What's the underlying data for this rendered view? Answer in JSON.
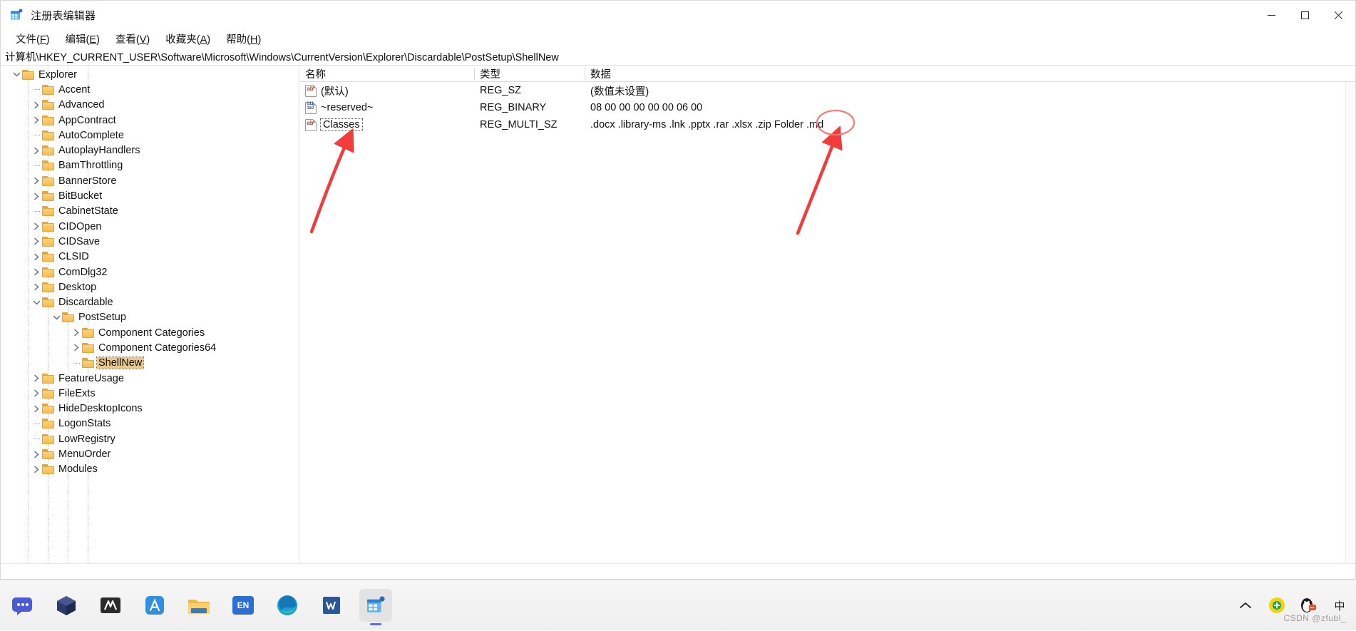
{
  "window": {
    "title": "注册表编辑器",
    "app_icon": "registry-editor-icon",
    "controls": {
      "minimize": "最小化",
      "maximize": "最大化",
      "close": "关闭"
    }
  },
  "menubar": {
    "items": [
      {
        "label": "文件(F)",
        "text": "文件",
        "accel": "F"
      },
      {
        "label": "编辑(E)",
        "text": "编辑",
        "accel": "E"
      },
      {
        "label": "查看(V)",
        "text": "查看",
        "accel": "V"
      },
      {
        "label": "收藏夹(A)",
        "text": "收藏夹",
        "accel": "A"
      },
      {
        "label": "帮助(H)",
        "text": "帮助",
        "accel": "H"
      }
    ]
  },
  "address": {
    "path": "计算机\\HKEY_CURRENT_USER\\Software\\Microsoft\\Windows\\CurrentVersion\\Explorer\\Discardable\\PostSetup\\ShellNew"
  },
  "tree": {
    "items": [
      {
        "label": "Explorer",
        "indent": 0,
        "state": "expanded",
        "selected": false
      },
      {
        "label": "Accent",
        "indent": 1,
        "state": "leaf",
        "selected": false
      },
      {
        "label": "Advanced",
        "indent": 1,
        "state": "collapsed",
        "selected": false
      },
      {
        "label": "AppContract",
        "indent": 1,
        "state": "collapsed",
        "selected": false
      },
      {
        "label": "AutoComplete",
        "indent": 1,
        "state": "leaf",
        "selected": false
      },
      {
        "label": "AutoplayHandlers",
        "indent": 1,
        "state": "collapsed",
        "selected": false
      },
      {
        "label": "BamThrottling",
        "indent": 1,
        "state": "leaf",
        "selected": false
      },
      {
        "label": "BannerStore",
        "indent": 1,
        "state": "collapsed",
        "selected": false
      },
      {
        "label": "BitBucket",
        "indent": 1,
        "state": "collapsed",
        "selected": false
      },
      {
        "label": "CabinetState",
        "indent": 1,
        "state": "leaf",
        "selected": false
      },
      {
        "label": "CIDOpen",
        "indent": 1,
        "state": "collapsed",
        "selected": false
      },
      {
        "label": "CIDSave",
        "indent": 1,
        "state": "collapsed",
        "selected": false
      },
      {
        "label": "CLSID",
        "indent": 1,
        "state": "collapsed",
        "selected": false
      },
      {
        "label": "ComDlg32",
        "indent": 1,
        "state": "collapsed",
        "selected": false
      },
      {
        "label": "Desktop",
        "indent": 1,
        "state": "collapsed",
        "selected": false
      },
      {
        "label": "Discardable",
        "indent": 1,
        "state": "expanded",
        "selected": false
      },
      {
        "label": "PostSetup",
        "indent": 2,
        "state": "expanded",
        "selected": false
      },
      {
        "label": "Component Categories",
        "indent": 3,
        "state": "collapsed",
        "selected": false
      },
      {
        "label": "Component Categories64",
        "indent": 3,
        "state": "collapsed",
        "selected": false
      },
      {
        "label": "ShellNew",
        "indent": 3,
        "state": "leaf",
        "selected": true
      },
      {
        "label": "FeatureUsage",
        "indent": 1,
        "state": "collapsed",
        "selected": false
      },
      {
        "label": "FileExts",
        "indent": 1,
        "state": "collapsed",
        "selected": false
      },
      {
        "label": "HideDesktopIcons",
        "indent": 1,
        "state": "collapsed",
        "selected": false
      },
      {
        "label": "LogonStats",
        "indent": 1,
        "state": "leaf",
        "selected": false
      },
      {
        "label": "LowRegistry",
        "indent": 1,
        "state": "leaf",
        "selected": false
      },
      {
        "label": "MenuOrder",
        "indent": 1,
        "state": "collapsed",
        "selected": false
      },
      {
        "label": "Modules",
        "indent": 1,
        "state": "collapsed",
        "selected": false
      }
    ]
  },
  "list": {
    "columns": {
      "name": "名称",
      "type": "类型",
      "data": "数据"
    },
    "rows": [
      {
        "name": "(默认)",
        "icon": "string-value-icon",
        "type": "REG_SZ",
        "data": "(数值未设置)",
        "selected": false
      },
      {
        "name": "~reserved~",
        "icon": "binary-value-icon",
        "type": "REG_BINARY",
        "data": "08 00 00 00 00 00 06 00",
        "selected": false
      },
      {
        "name": "Classes",
        "icon": "string-value-icon",
        "type": "REG_MULTI_SZ",
        "data": ".docx .library-ms .lnk .pptx .rar .xlsx .zip Folder .md",
        "selected": true
      }
    ]
  },
  "annotations": {
    "color": "#f23c3c",
    "arrow_to_classes": "points at Classes value name",
    "ellipse_around_md": ".md",
    "ellipse_label": ".md"
  },
  "taskbar": {
    "apps": [
      {
        "name": "chat-icon",
        "label": "聊天"
      },
      {
        "name": "3d-viewer-icon",
        "label": "3D 查看器"
      },
      {
        "name": "app-m-icon",
        "label": "M"
      },
      {
        "name": "app-a-icon",
        "label": "A"
      },
      {
        "name": "file-explorer-icon",
        "label": "文件资源管理器"
      },
      {
        "name": "ime-en-icon",
        "label": "EN"
      },
      {
        "name": "edge-icon",
        "label": "Microsoft Edge"
      },
      {
        "name": "word-icon",
        "label": "W"
      },
      {
        "name": "registry-editor-icon",
        "label": "注册表编辑器",
        "active": true
      }
    ],
    "tray": [
      {
        "name": "show-hidden-icons-chevron",
        "label": "^"
      },
      {
        "name": "360-security-icon",
        "label": "安全卫士"
      },
      {
        "name": "qq-icon",
        "label": "QQ"
      },
      {
        "name": "ime-indicator",
        "label": "中"
      }
    ],
    "watermark": "CSDN @zfubl_"
  }
}
